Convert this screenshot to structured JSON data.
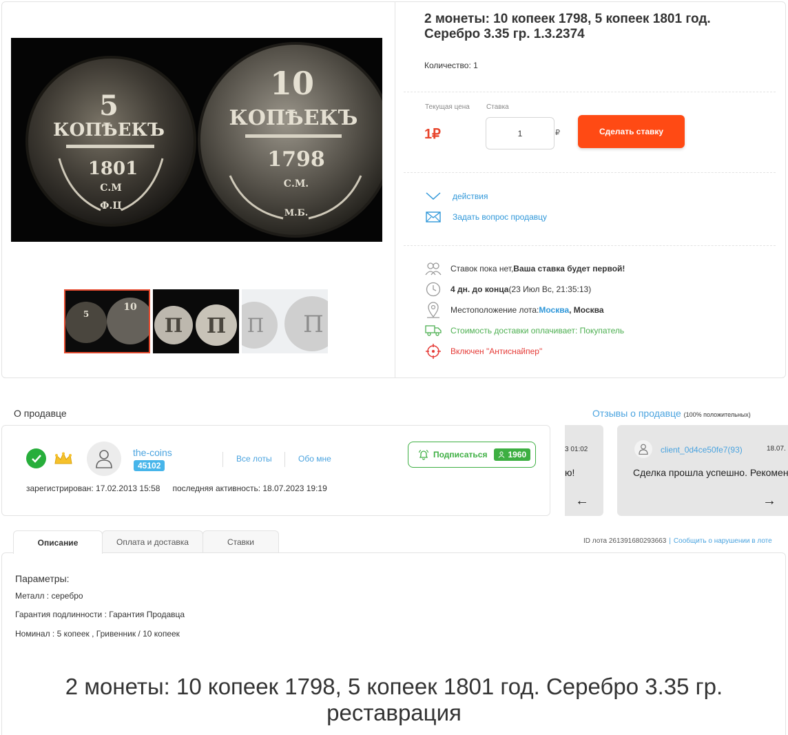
{
  "lot": {
    "title": "2 монеты: 10 копеек 1798, 5 копеек 1801 год. Серебро 3.35 гр. 1.3.2374",
    "quantity": "Количество: 1",
    "price_label": "Текущая цена",
    "price": "1₽",
    "bid_label": "Ставка",
    "bid_value": "1",
    "bid_currency": "₽",
    "bid_button": "Сделать ставку",
    "coin_text": {
      "left_value": "5",
      "right_value": "10",
      "word": "КОПѢЕКЪ",
      "left_year": "1801",
      "right_year": "1798",
      "left_mint": "С.М",
      "right_mint": "С.М.",
      "left_mark": "Ф.Ц",
      "right_mark": "М.Б.",
      "monogram": "П"
    }
  },
  "actions": {
    "actions_link": "действия",
    "ask_seller": "Задать вопрос продавцу"
  },
  "info": {
    "bids_text": "Ставок пока нет, ",
    "bids_bold": "Ваша ставка будет первой!",
    "time_bold": "4 дн. до конца",
    "time_rest": " (23 Июл Вс, 21:35:13)",
    "location_label": "Местоположение лота:",
    "location_city": "Москва",
    "location_region": ", Москва",
    "shipping": "Стоимость доставки оплачивает: Покупатель",
    "antisniper": "Включен \"Антиснайпер\""
  },
  "seller": {
    "heading": "О продавце",
    "name": "the-coins",
    "rating": "45102",
    "all_lots": "Все лоты",
    "about": "Обо мне",
    "registered": "зарегистрирован: 17.02.2013 15:58",
    "last_active": "последняя активность: 18.07.2023 19:19",
    "subscribe": "Подписаться",
    "subscribers": "1960"
  },
  "reviews": {
    "heading": "Отзывы о продавце",
    "heading_note": "(100% положительных)",
    "left_date": "3 01:02",
    "left_text": "ю!",
    "right_user": "client_0d4ce50fe7(93)",
    "right_date": "18.07.",
    "right_text": "Сделка прошла успешно. Рекомен",
    "prev": "←",
    "next": "→"
  },
  "tabs": [
    {
      "label": "Описание"
    },
    {
      "label": "Оплата и доставка"
    },
    {
      "label": "Ставки"
    }
  ],
  "lot_meta": {
    "id": "ID лота 261391680293663",
    "separator": "|",
    "report": "Сообщить о нарушении в лоте"
  },
  "description": {
    "params_title": "Параметры:",
    "params": [
      "Металл : серебро",
      "Гарантия подлинности : Гарантия Продавца",
      "Номинал : 5 копеек , Гривенник / 10 копеек"
    ],
    "big_title": "2 монеты: 10 копеек 1798, 5 копеек 1801 год. Серебро 3.35 гр. реставрация"
  },
  "colors": {
    "accent_orange": "#ff4a14",
    "link_blue": "#2f97d9",
    "green": "#3daf42",
    "red": "#e53935"
  }
}
